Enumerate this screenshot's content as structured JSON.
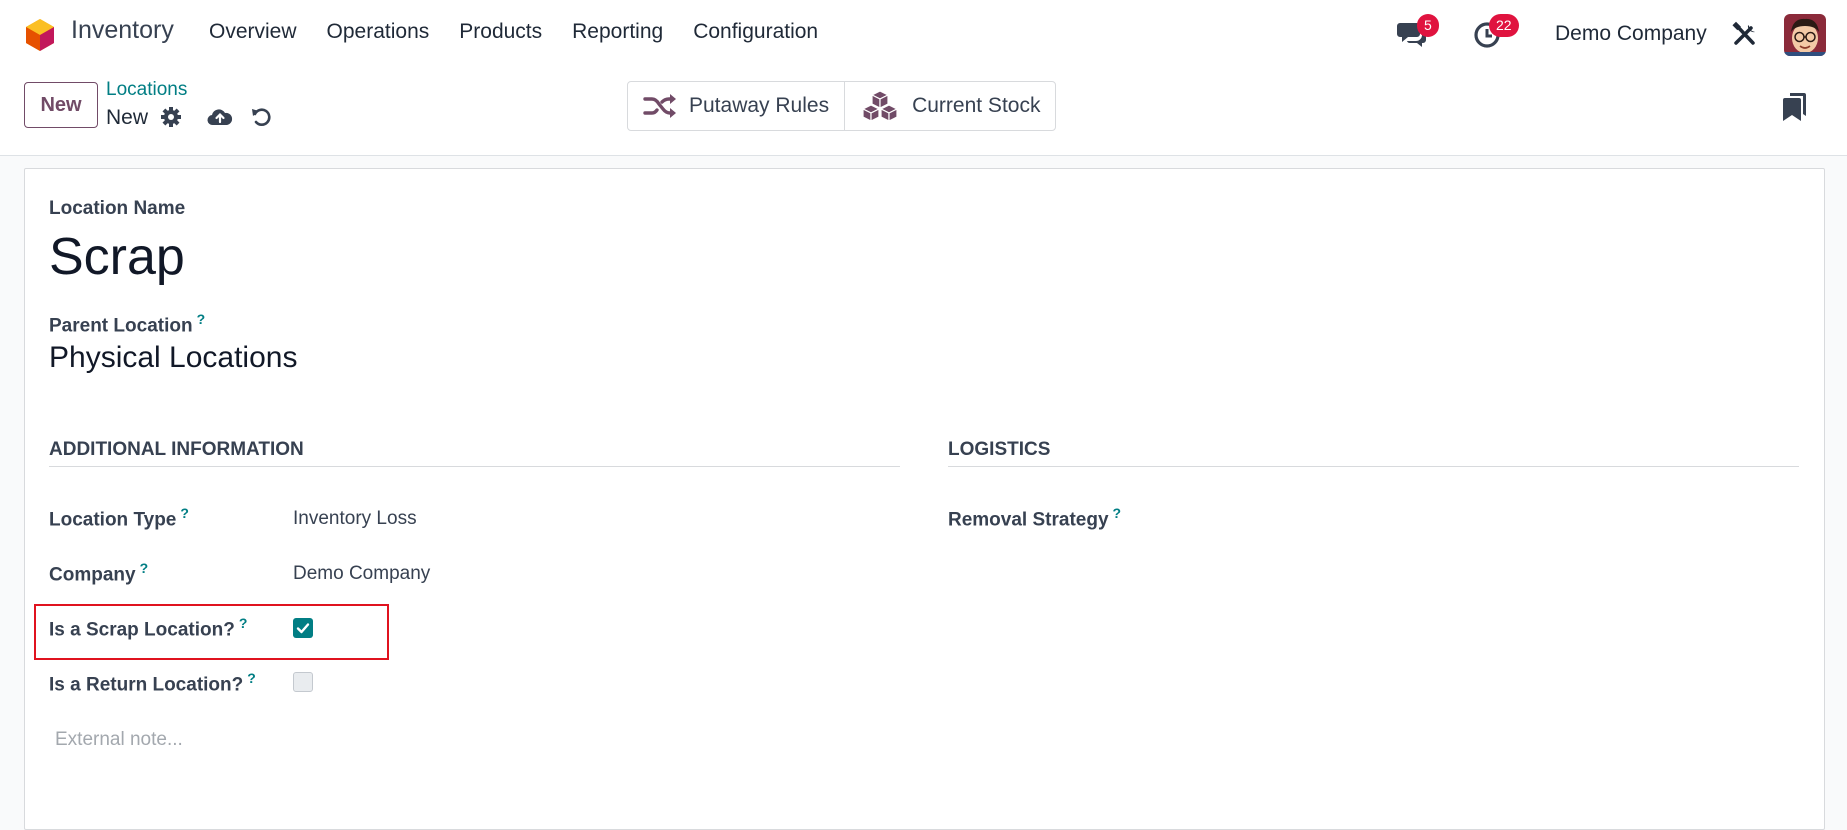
{
  "app": {
    "name": "Inventory",
    "menu": [
      "Overview",
      "Operations",
      "Products",
      "Reporting",
      "Configuration"
    ],
    "messages_count": "5",
    "activities_count": "22",
    "company": "Demo Company"
  },
  "controlbar": {
    "new_label": "New",
    "breadcrumb_parent": "Locations",
    "breadcrumb_current": "New",
    "smart_buttons": [
      "Putaway Rules",
      "Current Stock"
    ]
  },
  "form": {
    "name_label": "Location Name",
    "name_value": "Scrap",
    "parent_label": "Parent Location",
    "parent_value": "Physical Locations",
    "help_mark": "?",
    "sections": {
      "additional": "ADDITIONAL INFORMATION",
      "logistics": "LOGISTICS"
    },
    "location_type_label": "Location Type",
    "location_type_value": "Inventory Loss",
    "company_label": "Company",
    "company_value": "Demo Company",
    "scrap_label": "Is a Scrap Location?",
    "scrap_checked": true,
    "return_label": "Is a Return Location?",
    "return_checked": false,
    "removal_label": "Removal Strategy",
    "note_placeholder": "External note..."
  },
  "colors": {
    "brand": "#714b67",
    "accent": "#017e84",
    "badge": "#e0133f",
    "highlight": "#e0131f"
  }
}
